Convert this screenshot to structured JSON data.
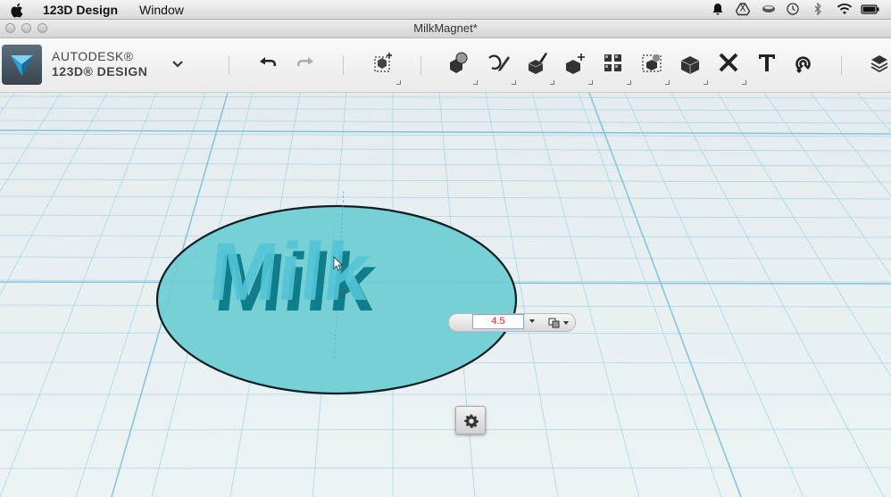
{
  "menubar": {
    "app_name": "123D Design",
    "items": [
      "Window"
    ]
  },
  "window": {
    "title": "MilkMagnet*"
  },
  "brand": {
    "company": "AUTODESK®",
    "product": "123D® DESIGN"
  },
  "toolbar": {
    "tools": [
      "undo-icon",
      "redo-icon",
      "transform-icon",
      "primitives-icon",
      "sketch-icon",
      "construct-icon",
      "modify-icon",
      "pattern-icon",
      "grouping-icon",
      "combine-icon",
      "measure-icon",
      "text-icon",
      "snap-icon",
      "materials-icon"
    ]
  },
  "scene": {
    "text_object": "Milk",
    "object_color": "#6ccdd3"
  },
  "dimension_control": {
    "value": "4.5"
  },
  "colors": {
    "grid_bg": "#e6eef1",
    "grid_line": "#9fd3e2",
    "accent_input": "#c22222"
  }
}
